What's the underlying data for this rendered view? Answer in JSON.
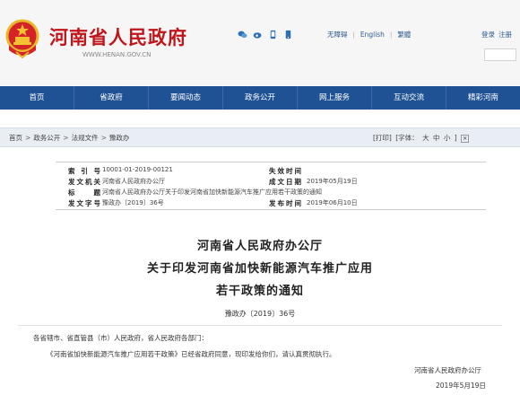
{
  "header": {
    "site_title": "河南省人民政府",
    "site_url": "WWW.HENAN.GOV.CN",
    "links": [
      "无障碍",
      "English",
      "繁體"
    ],
    "right_links": [
      "登录",
      "注册"
    ]
  },
  "nav": {
    "items": [
      "首页",
      "省政府",
      "要闻动态",
      "政务公开",
      "网上服务",
      "互动交流",
      "精彩河南"
    ]
  },
  "breadcrumb": {
    "items": [
      "首页",
      "政务公开",
      "法规文件",
      "豫政办"
    ],
    "tools": {
      "print": "[打印]",
      "font_label": "[字体：",
      "font_large": "大",
      "font_medium": "中",
      "font_small": "小",
      "font_end": "]"
    }
  },
  "meta": {
    "index_label": "索引号",
    "index_value": "10001-01-2019-00121",
    "valid_label": "失效时间",
    "issuer_label": "发文机关",
    "issuer_value": "河南省人民政府办公厅",
    "date_label": "成文日期",
    "date_value": "2019年05月19日",
    "title_label": "标题",
    "title_value": "河南省人民政府办公厅关于印发河南省加快新能源汽车推广应用若干政策的通知",
    "docno_label": "发文字号",
    "docno_value": "豫政办〔2019〕36号",
    "pubdate_label": "发布时间",
    "pubdate_value": "2019年06月10日"
  },
  "article": {
    "title_line1": "河南省人民政府办公厅",
    "title_line2": "关于印发河南省加快新能源汽车推广应用",
    "title_line3": "若干政策的通知",
    "doc_number": "豫政办〔2019〕36号",
    "salutation": "各省辖市、省直管县（市）人民政府，省人民政府各部门：",
    "body": "《河南省加快新能源汽车推广应用若干政策》已经省政府同意，现印发给你们，请认真贯彻执行。",
    "signature": "河南省人民政府办公厅",
    "sign_date": "2019年5月19日"
  },
  "colors": {
    "brand_red": "#c0161b",
    "nav_blue": "#1f5294",
    "link_blue": "#2d5a93"
  }
}
